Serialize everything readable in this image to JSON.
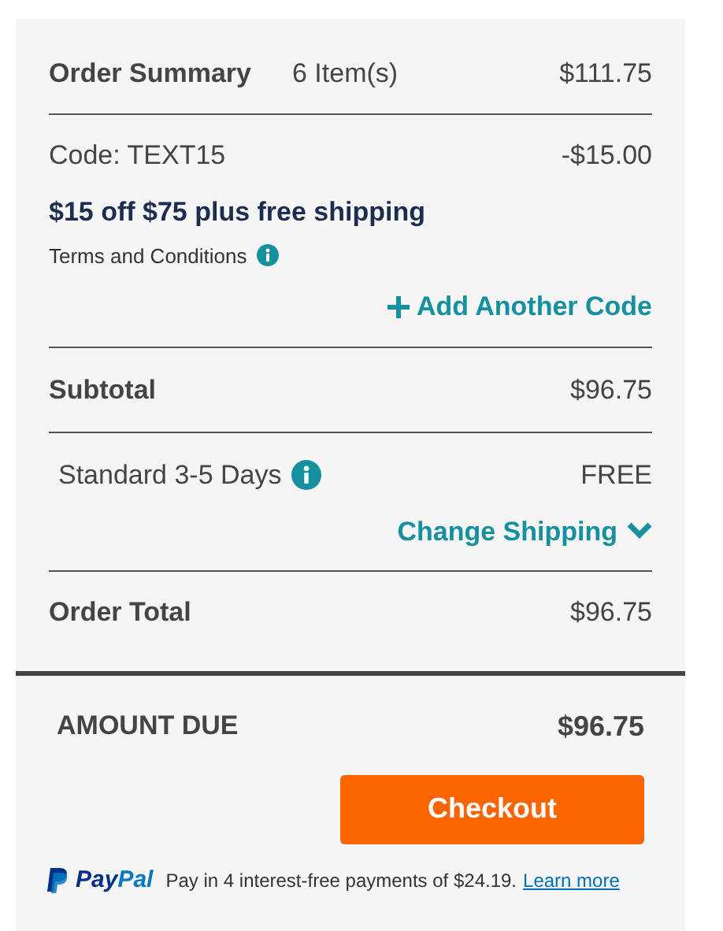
{
  "summary": {
    "title": "Order Summary",
    "item_count": "6 Item(s)",
    "amount": "$111.75"
  },
  "promo": {
    "code_label": "Code: TEXT15",
    "discount": "-$15.00",
    "description": "$15 off $75 plus free shipping",
    "terms_link": "Terms and Conditions",
    "add_code": "Add Another Code"
  },
  "subtotal": {
    "label": "Subtotal",
    "amount": "$96.75"
  },
  "shipping": {
    "method": "Standard 3-5 Days",
    "price": "FREE",
    "change_link": "Change Shipping",
    "expanded": false
  },
  "order_total": {
    "label": "Order Total",
    "amount": "$96.75"
  },
  "amount_due": {
    "label": "AMOUNT DUE",
    "amount": "$96.75"
  },
  "checkout_button": "Checkout",
  "paypal": {
    "brand_first": "Pay",
    "brand_second": "Pal",
    "message": "Pay in 4 interest-free payments of $24.19.",
    "link": "Learn more"
  }
}
